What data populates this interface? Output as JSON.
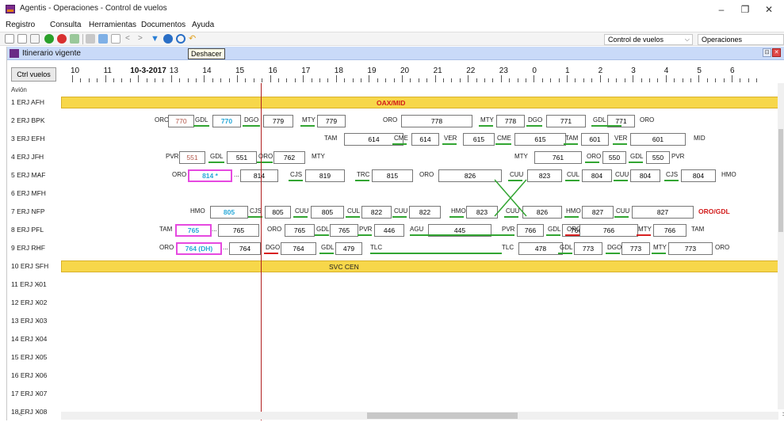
{
  "window": {
    "title": "Agentis - Operaciones - Control de vuelos",
    "min": "–",
    "max": "❐",
    "close": "✕"
  },
  "menu": [
    "Registro",
    "Consulta",
    "Herramientas",
    "Documentos",
    "Ayuda"
  ],
  "toolbar": {
    "combo1": "Control de vuelos",
    "combo2": "Operaciones",
    "combo_arrow": "⌵"
  },
  "mdi": {
    "title": "Itinerario vigente",
    "tooltip": "Deshacer",
    "restore": "⊡",
    "close": "✕"
  },
  "grid": {
    "ctrl_button": "Ctrl vuelos",
    "avion_label": "Avión",
    "ruler": [
      {
        "t": "10"
      },
      {
        "t": "11"
      },
      {
        "t": "10-3-2017"
      },
      {
        "t": "13"
      },
      {
        "t": "14"
      },
      {
        "t": "15"
      },
      {
        "t": "16"
      },
      {
        "t": "17"
      },
      {
        "t": "18"
      },
      {
        "t": "19"
      },
      {
        "t": "20"
      },
      {
        "t": "21"
      },
      {
        "t": "22"
      },
      {
        "t": "23"
      },
      {
        "t": "0"
      },
      {
        "t": "1"
      },
      {
        "t": "2"
      },
      {
        "t": "3"
      },
      {
        "t": "4"
      },
      {
        "t": "5"
      },
      {
        "t": "6"
      }
    ],
    "rows": [
      {
        "label": "1 ERJ AFH",
        "dash": "-",
        "bar": "OAX/MID",
        "bar_red": "OAX/MID"
      },
      {
        "label": "2 ERJ BPK",
        "dash": "-"
      },
      {
        "label": "3 ERJ EFH",
        "dash": "-"
      },
      {
        "label": "4 ERJ JFH",
        "dash": "-"
      },
      {
        "label": "5 ERJ MAF",
        "dash": "-"
      },
      {
        "label": "6 ERJ MFH",
        "dash": "-"
      },
      {
        "label": "7 ERJ NFP",
        "dash": "-"
      },
      {
        "label": "8 ERJ PFL",
        "dash": "-"
      },
      {
        "label": "9 ERJ RHF",
        "dash": "-"
      },
      {
        "label": "10 ERJ SFH",
        "dash": "-",
        "bar": "SVC CEN"
      },
      {
        "label": "11 ERJ X01",
        "dash": "-"
      },
      {
        "label": "12 ERJ X02",
        "dash": "-"
      },
      {
        "label": "13 ERJ X03",
        "dash": "-"
      },
      {
        "label": "14 ERJ X04",
        "dash": "-"
      },
      {
        "label": "15 ERJ X05",
        "dash": "-"
      },
      {
        "label": "16 ERJ X06",
        "dash": "-"
      },
      {
        "label": "17 ERJ X07",
        "dash": "-"
      },
      {
        "label": "18 ERJ X08",
        "dash": "-"
      }
    ],
    "segments": {
      "r2": [
        "ORO",
        "770",
        "GDL",
        "770",
        "DGO",
        "779",
        "MTY",
        "779",
        "ORO",
        "778",
        "MTY",
        "778",
        "DGO",
        "771",
        "GDL",
        "771",
        "ORO"
      ],
      "r3": [
        "TAM",
        "614",
        "CME",
        "614",
        "VER",
        "615",
        "CME",
        "615",
        "TAM",
        "601",
        "VER",
        "601",
        "MID"
      ],
      "r4": [
        "PVR",
        "551",
        "GDL",
        "551",
        "ORO",
        "762",
        "MTY",
        "MTY",
        "761",
        "ORO",
        "550",
        "GDL",
        "550",
        "PVR"
      ],
      "r5": [
        "ORO",
        "814 *",
        "...",
        "814",
        "CJS",
        "819",
        "TRC",
        "815",
        "ORO",
        "826",
        "CUU",
        "823",
        "CUL",
        "804",
        "CUU",
        "804",
        "CJS",
        "804",
        "HMO"
      ],
      "r7": [
        "HMO",
        "805",
        "CJS",
        "805",
        "CUU",
        "805",
        "CUL",
        "822",
        "CUU",
        "822",
        "HMO",
        "823",
        "CUU",
        "826",
        "HMO",
        "827",
        "CUU",
        "827",
        "ORO/GDL"
      ],
      "r8": [
        "TAM",
        "765",
        "...",
        "765",
        "ORO",
        "765",
        "GDL",
        "765",
        "PVR",
        "446",
        "AGU",
        "445",
        "PVR",
        "766",
        "GDL",
        "766",
        "ORO",
        "766",
        "MTY",
        "766",
        "TAM"
      ],
      "r9": [
        "ORO",
        "764 (DH)",
        "...",
        "764",
        "DGO",
        "764",
        "GDL",
        "479",
        "TLC",
        "TLC",
        "478",
        "GDL",
        "773",
        "DGO",
        "773",
        "MTY",
        "773",
        "ORO"
      ]
    },
    "hscroll": {
      "left": "<",
      "right": ">"
    }
  }
}
